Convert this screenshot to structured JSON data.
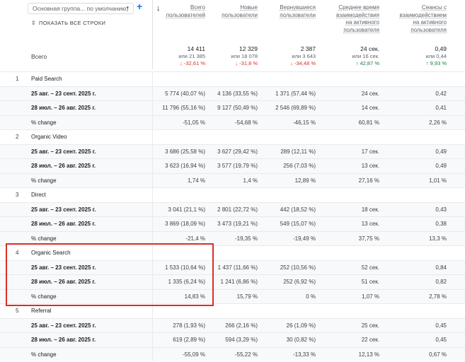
{
  "dimension_select": {
    "value": "Основная группа... по умолчанию)",
    "caret": "▾"
  },
  "add_button": "+",
  "show_all_rows": "ПОКАЗАТЬ ВСЕ СТРОКИ",
  "total_label": "Всего",
  "sort_icon": "↓",
  "columns": [
    {
      "lines": [
        "Всего",
        "пользователей"
      ]
    },
    {
      "lines": [
        "Новые",
        "пользователи"
      ]
    },
    {
      "lines": [
        "Вернувшиеся",
        "пользователи"
      ]
    },
    {
      "lines": [
        "Среднее время",
        "взаимодействия",
        "на активного",
        "пользователя"
      ]
    },
    {
      "lines": [
        "Сеансы с",
        "взаимодействием",
        "на активного",
        "пользователя"
      ]
    }
  ],
  "totals": [
    {
      "value": "14 411",
      "sub": "или 21 385",
      "change": "↓ -32,61 %",
      "dir": "neg"
    },
    {
      "value": "12 329",
      "sub": "или 18 078",
      "change": "↓ -31,8 %",
      "dir": "neg"
    },
    {
      "value": "2 387",
      "sub": "или 3 643",
      "change": "↓ -34,48 %",
      "dir": "neg"
    },
    {
      "value": "24 сек.",
      "sub": "или 16 сек.",
      "change": "↑ 42,87 %",
      "dir": "pos"
    },
    {
      "value": "0,49",
      "sub": "или 0,44",
      "change": "↑ 9,93 %",
      "dir": "pos"
    }
  ],
  "rows": [
    {
      "kind": "grp",
      "idx": "1",
      "label": "Paid Search",
      "cells": [
        "",
        "",
        "",
        "",
        ""
      ]
    },
    {
      "kind": "dat",
      "idx": "",
      "label": "25 авг. – 23 сент. 2025 г.",
      "cells": [
        "5 774 (40,07 %)",
        "4 136 (33,55 %)",
        "1 371 (57,44 %)",
        "24 сек.",
        "0,42"
      ]
    },
    {
      "kind": "dat",
      "idx": "",
      "label": "28 июл. – 26 авг. 2025 г.",
      "cells": [
        "11 796 (55,16 %)",
        "9 127 (50,49 %)",
        "2 546 (69,89 %)",
        "14 сек.",
        "0,41"
      ]
    },
    {
      "kind": "chg",
      "idx": "",
      "label": "% change",
      "cells": [
        "-51,05 %",
        "-54,68 %",
        "-46,15 %",
        "60,81 %",
        "2,26 %"
      ]
    },
    {
      "kind": "grp",
      "idx": "2",
      "label": "Organic Video",
      "cells": [
        "",
        "",
        "",
        "",
        ""
      ]
    },
    {
      "kind": "dat",
      "idx": "",
      "label": "25 авг. – 23 сент. 2025 г.",
      "cells": [
        "3 686 (25,58 %)",
        "3 627 (29,42 %)",
        "289 (12,11 %)",
        "17 сек.",
        "0,49"
      ]
    },
    {
      "kind": "dat",
      "idx": "",
      "label": "28 июл. – 26 авг. 2025 г.",
      "cells": [
        "3 623 (16,94 %)",
        "3 577 (19,79 %)",
        "256 (7,03 %)",
        "13 сек.",
        "0,49"
      ]
    },
    {
      "kind": "chg",
      "idx": "",
      "label": "% change",
      "cells": [
        "1,74 %",
        "1,4 %",
        "12,89 %",
        "27,16 %",
        "1,01 %"
      ]
    },
    {
      "kind": "grp",
      "idx": "3",
      "label": "Direct",
      "cells": [
        "",
        "",
        "",
        "",
        ""
      ]
    },
    {
      "kind": "dat",
      "idx": "",
      "label": "25 авг. – 23 сент. 2025 г.",
      "cells": [
        "3 041 (21,1 %)",
        "2 801 (22,72 %)",
        "442 (18,52 %)",
        "18 сек.",
        "0,43"
      ]
    },
    {
      "kind": "dat",
      "idx": "",
      "label": "28 июл. – 26 авг. 2025 г.",
      "cells": [
        "3 869 (18,09 %)",
        "3 473 (19,21 %)",
        "549 (15,07 %)",
        "13 сек.",
        "0,38"
      ]
    },
    {
      "kind": "chg",
      "idx": "",
      "label": "% change",
      "cells": [
        "-21,4 %",
        "-19,35 %",
        "-19,49 %",
        "37,75 %",
        "13,3 %"
      ]
    },
    {
      "kind": "grp",
      "idx": "4",
      "label": "Organic Search",
      "cells": [
        "",
        "",
        "",
        "",
        ""
      ]
    },
    {
      "kind": "dat",
      "idx": "",
      "label": "25 авг. – 23 сент. 2025 г.",
      "cells": [
        "1 533 (10,64 %)",
        "1 437 (11,66 %)",
        "252 (10,56 %)",
        "52 сек.",
        "0,84"
      ]
    },
    {
      "kind": "dat",
      "idx": "",
      "label": "28 июл. – 26 авг. 2025 г.",
      "cells": [
        "1 335 (6,24 %)",
        "1 241 (6,86 %)",
        "252 (6,92 %)",
        "51 сек.",
        "0,82"
      ]
    },
    {
      "kind": "chg",
      "idx": "",
      "label": "% change",
      "cells": [
        "14,83 %",
        "15,79 %",
        "0 %",
        "1,07 %",
        "2,78 %"
      ]
    },
    {
      "kind": "grp",
      "idx": "5",
      "label": "Referral",
      "cells": [
        "",
        "",
        "",
        "",
        ""
      ]
    },
    {
      "kind": "dat",
      "idx": "",
      "label": "25 авг. – 23 сент. 2025 г.",
      "cells": [
        "278 (1,93 %)",
        "266 (2,16 %)",
        "26 (1,09 %)",
        "25 сек.",
        "0,45"
      ]
    },
    {
      "kind": "dat",
      "idx": "",
      "label": "28 июл. – 26 авг. 2025 г.",
      "cells": [
        "619 (2,89 %)",
        "594 (3,29 %)",
        "30 (0,82 %)",
        "22 сек.",
        "0,45"
      ]
    },
    {
      "kind": "chg",
      "idx": "",
      "label": "% change",
      "cells": [
        "-55,09 %",
        "-55,22 %",
        "-13,33 %",
        "12,13 %",
        "0,67 %"
      ]
    }
  ]
}
